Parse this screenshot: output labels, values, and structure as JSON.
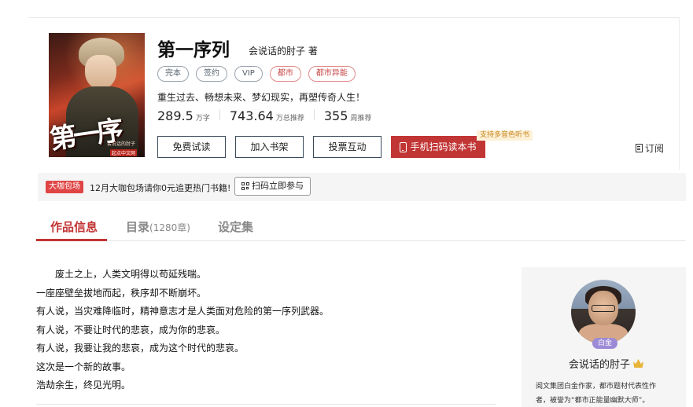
{
  "book": {
    "title": "第一序列",
    "author_line": "会说话的肘子  著",
    "cover_title": "第一序列",
    "cover_subtitle": "会说话的肘子",
    "cover_publisher": "起点中文网",
    "tags": [
      {
        "label": "完本",
        "style": "gray"
      },
      {
        "label": "签约",
        "style": "gray"
      },
      {
        "label": "VIP",
        "style": "gray"
      },
      {
        "label": "都市",
        "style": "red"
      },
      {
        "label": "都市异能",
        "style": "red"
      }
    ],
    "intro": "重生过去、畅想未来、梦幻现实，再塑传奇人生！",
    "stats": [
      {
        "value": "289.5",
        "unit": "万字"
      },
      {
        "value": "743.64",
        "unit": "万总推荐"
      },
      {
        "value": "355",
        "unit": "周推荐"
      }
    ]
  },
  "actions": {
    "free_read": "免费试读",
    "add_shelf": "加入书架",
    "vote": "投票互动",
    "scan_read": "手机扫码读本书",
    "audio_badge": "支持多音色听书",
    "subscribe": "订阅"
  },
  "promo": {
    "badge": "大咖包场",
    "text": "12月大咖包场请你0元追更热门书籍!",
    "button": "扫码立即参与"
  },
  "tabs": [
    {
      "label": "作品信息",
      "count": "",
      "active": true
    },
    {
      "label": "目录",
      "count": "(1280章)",
      "active": false
    },
    {
      "label": "设定集",
      "count": "",
      "active": false
    }
  ],
  "synopsis": [
    "废土之上，人类文明得以苟延残喘。",
    "一座座壁垒拔地而起，秩序却不断崩坏。",
    "有人说，当灾难降临时，精神意志才是人类面对危险的第一序列武器。",
    "有人说，不要让时代的悲哀，成为你的悲哀。",
    "有人说，我要让我的悲哀，成为这个时代的悲哀。",
    "这次是一个新的故事。",
    "浩劫余生，终见光明。"
  ],
  "author_card": {
    "level": "白金",
    "name": "会说话的肘子",
    "bio_line1": "阅文集团白金作家，都市题材代表性作",
    "bio_line2": "者，被誉为“都市正能量幽默大师”。"
  },
  "colors": {
    "accent": "#c23535",
    "badge_red": "#e04545",
    "tag_red": "#c84545",
    "level_purple": "#9c8ad6",
    "audio_gold": "#c8851a"
  }
}
